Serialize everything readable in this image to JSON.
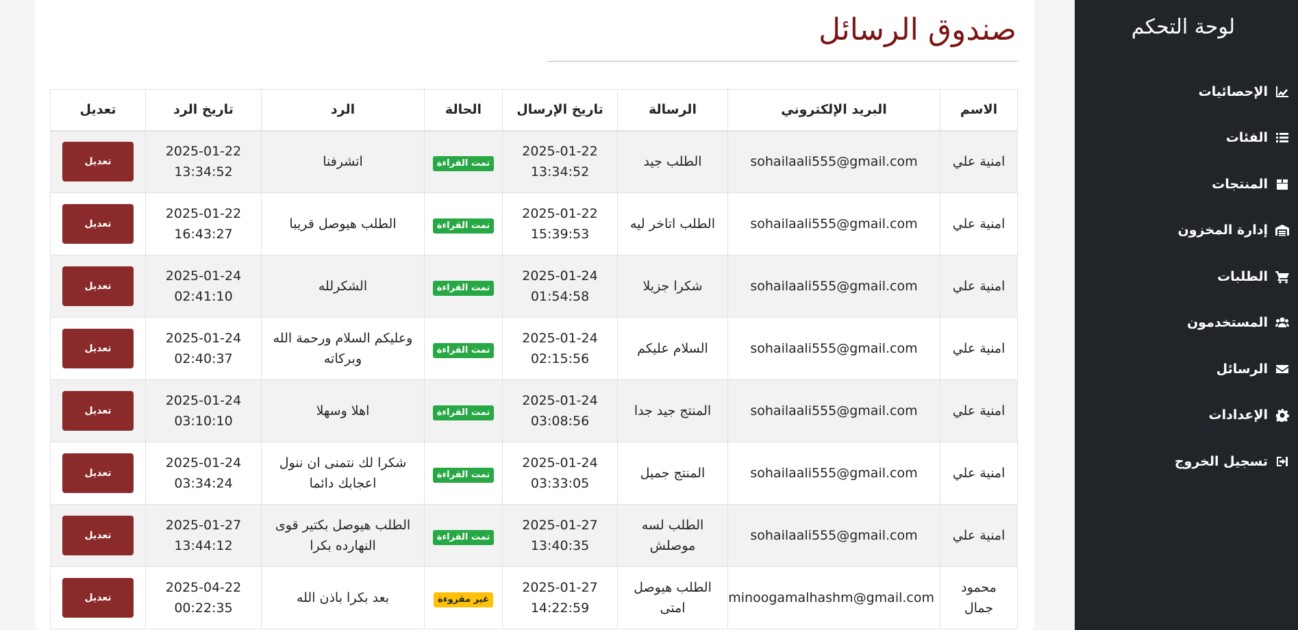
{
  "sidebar": {
    "title": "لوحة التحكم",
    "items": [
      {
        "label": "الإحصائيات",
        "icon": "chart-icon"
      },
      {
        "label": "الفئات",
        "icon": "list-icon"
      },
      {
        "label": "المنتجات",
        "icon": "box-icon"
      },
      {
        "label": "إدارة المخزون",
        "icon": "warehouse-icon"
      },
      {
        "label": "الطلبات",
        "icon": "cart-icon"
      },
      {
        "label": "المستخدمون",
        "icon": "users-icon"
      },
      {
        "label": "الرسائل",
        "icon": "envelope-icon"
      },
      {
        "label": "الإعدادات",
        "icon": "gear-icon"
      },
      {
        "label": "تسجيل الخروج",
        "icon": "logout-icon"
      }
    ]
  },
  "main": {
    "title": "صندوق الرسائل",
    "columns": [
      "الاسم",
      "البريد الإلكتروني",
      "الرسالة",
      "تاريخ الإرسال",
      "الحالة",
      "الرد",
      "تاريخ الرد",
      "تعديل"
    ],
    "edit_label": "تعديل",
    "rows": [
      {
        "name": "امنية علي",
        "email": "sohailaali555@gmail.com",
        "message": "الطلب جيد",
        "sent_date": "2025-01-22",
        "sent_time": "13:34:52",
        "status": "تمت القراءة",
        "status_type": "read",
        "reply": "اتشرفنا",
        "reply_date": "2025-01-22",
        "reply_time": "13:34:52"
      },
      {
        "name": "امنية علي",
        "email": "sohailaali555@gmail.com",
        "message": "الطلب اتاخر ليه",
        "sent_date": "2025-01-22",
        "sent_time": "15:39:53",
        "status": "تمت القراءة",
        "status_type": "read",
        "reply": "الطلب هيوصل قريبا",
        "reply_date": "2025-01-22",
        "reply_time": "16:43:27"
      },
      {
        "name": "امنية علي",
        "email": "sohailaali555@gmail.com",
        "message": "شكرا جزيلا",
        "sent_date": "2025-01-24",
        "sent_time": "01:54:58",
        "status": "تمت القراءة",
        "status_type": "read",
        "reply": "الشكرلله",
        "reply_date": "2025-01-24",
        "reply_time": "02:41:10"
      },
      {
        "name": "امنية علي",
        "email": "sohailaali555@gmail.com",
        "message": "السلام عليكم",
        "sent_date": "2025-01-24",
        "sent_time": "02:15:56",
        "status": "تمت القراءة",
        "status_type": "read",
        "reply": "وعليكم السلام ورحمة الله وبركاته",
        "reply_date": "2025-01-24",
        "reply_time": "02:40:37"
      },
      {
        "name": "امنية علي",
        "email": "sohailaali555@gmail.com",
        "message": "المنتج جيد جدا",
        "sent_date": "2025-01-24",
        "sent_time": "03:08:56",
        "status": "تمت القراءة",
        "status_type": "read",
        "reply": "اهلا وسهلا",
        "reply_date": "2025-01-24",
        "reply_time": "03:10:10"
      },
      {
        "name": "امنية علي",
        "email": "sohailaali555@gmail.com",
        "message": "المنتج جميل",
        "sent_date": "2025-01-24",
        "sent_time": "03:33:05",
        "status": "تمت القراءة",
        "status_type": "read",
        "reply": "شكرا لك نتمنى ان ننول اعجابك دائما",
        "reply_date": "2025-01-24",
        "reply_time": "03:34:24"
      },
      {
        "name": "امنية علي",
        "email": "sohailaali555@gmail.com",
        "message": "الطلب لسه موصلش",
        "sent_date": "2025-01-27",
        "sent_time": "13:40:35",
        "status": "تمت القراءة",
        "status_type": "read",
        "reply": "الطلب هيوصل بكتير قوى النهارده بكرا",
        "reply_date": "2025-01-27",
        "reply_time": "13:44:12"
      },
      {
        "name": "محمود جمال",
        "email": "minoogamalhashm@gmail.com",
        "message": "الطلب هيوصل امتى",
        "sent_date": "2025-01-27",
        "sent_time": "14:22:59",
        "status": "غير مقروءة",
        "status_type": "unread",
        "reply": "بعد بكرا باذن الله",
        "reply_date": "2025-04-22",
        "reply_time": "00:22:35"
      }
    ]
  },
  "colors": {
    "sidebar_bg": "#212529",
    "title": "#7a1515",
    "edit_button": "#8b2a2a",
    "read_badge": "#27a844",
    "unread_badge": "#ffc107"
  }
}
